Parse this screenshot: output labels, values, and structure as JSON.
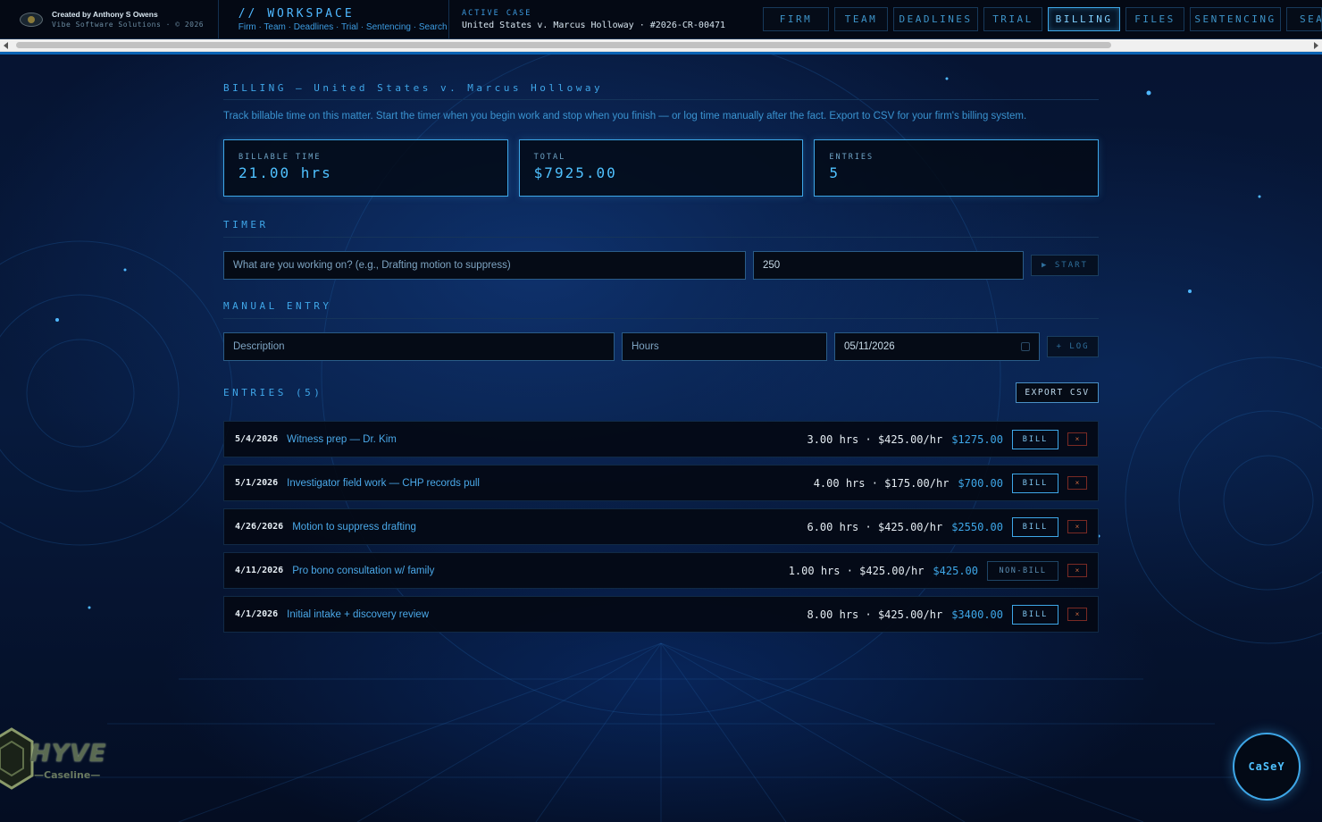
{
  "brand": {
    "created_by": "Created by Anthony S Owens",
    "company": "Vibe Software Solutions · © 2026"
  },
  "workspace": {
    "title": "// WORKSPACE",
    "subtitle": "Firm · Team · Deadlines · Trial · Sentencing · Search"
  },
  "active_case": {
    "label": "ACTIVE CASE",
    "name": "United States v. Marcus Holloway · #2026-CR-00471"
  },
  "nav": {
    "items": [
      {
        "label": "FIRM"
      },
      {
        "label": "TEAM"
      },
      {
        "label": "DEADLINES"
      },
      {
        "label": "TRIAL"
      },
      {
        "label": "BILLING",
        "active": true
      },
      {
        "label": "FILES"
      },
      {
        "label": "SENTENCING"
      },
      {
        "label": "SEA"
      }
    ]
  },
  "billing": {
    "title": "BILLING — United States v. Marcus Holloway",
    "intro": "Track billable time on this matter. Start the timer when you begin work and stop when you finish — or log time manually after the fact. Export to CSV for your firm's billing system."
  },
  "stats": {
    "billable_label": "BILLABLE TIME",
    "billable_value": "21.00 hrs",
    "total_label": "TOTAL",
    "total_value": "$7925.00",
    "entries_label": "ENTRIES",
    "entries_value": "5"
  },
  "timer": {
    "title": "TIMER",
    "task_placeholder": "What are you working on? (e.g., Drafting motion to suppress)",
    "rate_value": "250",
    "start_label": "▶ START"
  },
  "manual": {
    "title": "MANUAL ENTRY",
    "description_placeholder": "Description",
    "hours_placeholder": "Hours",
    "date_value": "05/11/2026",
    "log_label": "+ LOG"
  },
  "entries": {
    "title": "ENTRIES (5)",
    "export_label": "EXPORT CSV",
    "rows": [
      {
        "date": "5/4/2026",
        "description": "Witness prep — Dr. Kim",
        "hours_rate": "3.00 hrs · $425.00/hr",
        "amount": "$1275.00",
        "status": "BILL"
      },
      {
        "date": "5/1/2026",
        "description": "Investigator field work — CHP records pull",
        "hours_rate": "4.00 hrs · $175.00/hr",
        "amount": "$700.00",
        "status": "BILL"
      },
      {
        "date": "4/26/2026",
        "description": "Motion to suppress drafting",
        "hours_rate": "6.00 hrs · $425.00/hr",
        "amount": "$2550.00",
        "status": "BILL"
      },
      {
        "date": "4/11/2026",
        "description": "Pro bono consultation w/ family",
        "hours_rate": "1.00 hrs · $425.00/hr",
        "amount": "$425.00",
        "status": "NON-BILL"
      },
      {
        "date": "4/1/2026",
        "description": "Initial intake + discovery review",
        "hours_rate": "8.00 hrs · $425.00/hr",
        "amount": "$3400.00",
        "status": "BILL"
      }
    ],
    "delete_glyph": "×"
  },
  "logo": {
    "name": "HYVE",
    "sub": "—Caseline—"
  },
  "assistant": {
    "label": "CaSeY"
  },
  "colors": {
    "accent": "#3ea7e8",
    "background": "#050d1c",
    "delete": "#d06a40"
  }
}
